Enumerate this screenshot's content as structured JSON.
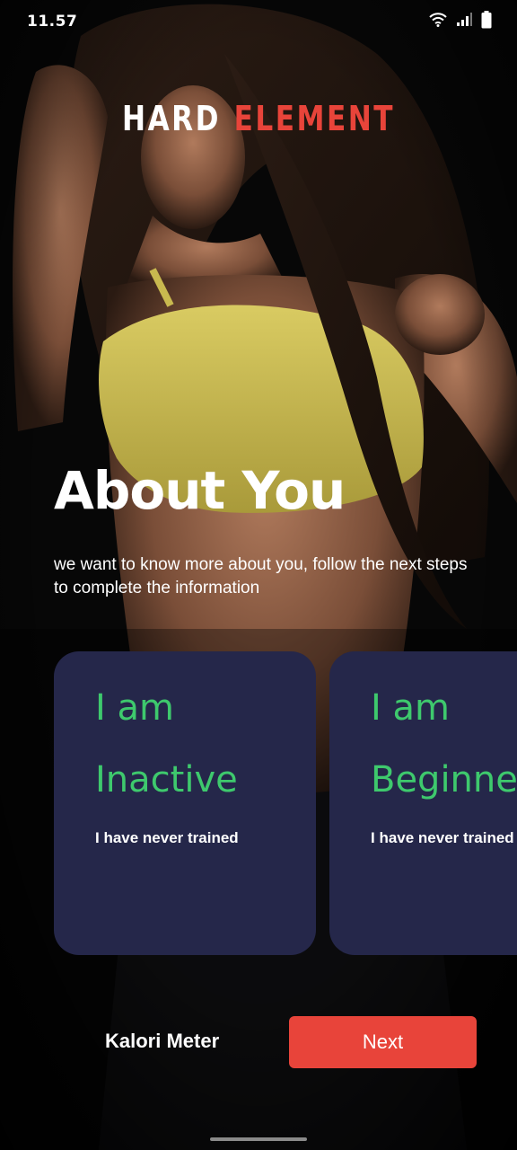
{
  "status_bar": {
    "time": "11.57",
    "icons": [
      "wifi-icon",
      "signal-icon",
      "battery-icon"
    ]
  },
  "brand": {
    "part1": "HARD",
    "part2": "ELEMENT",
    "accent_color": "#e8443a"
  },
  "intro": {
    "title": "About You",
    "subtitle": "we want to know more about you, follow the next steps\n to complete the information"
  },
  "cards": [
    {
      "line1": "I am",
      "line2": "Inactive",
      "description": "I have never trained"
    },
    {
      "line1": "I am",
      "line2": "Beginner",
      "description": "I have never trained"
    }
  ],
  "footer": {
    "app_name": "Kalori Meter",
    "next_label": "Next"
  },
  "colors": {
    "card_bg": "#25274a",
    "card_heading": "#3ec96d",
    "button": "#e8443a"
  }
}
